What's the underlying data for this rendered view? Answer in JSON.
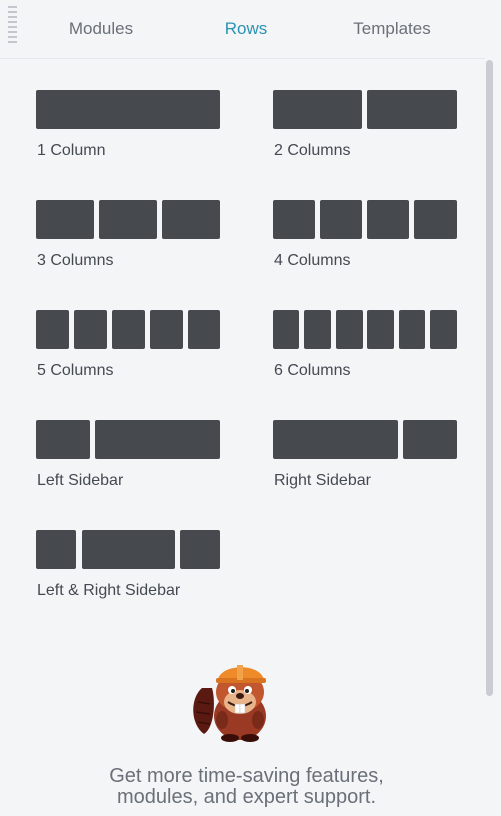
{
  "tabs": [
    {
      "label": "Modules",
      "active": false
    },
    {
      "label": "Rows",
      "active": true
    },
    {
      "label": "Templates",
      "active": false
    }
  ],
  "layouts": [
    {
      "id": "1col",
      "label": "1 Column"
    },
    {
      "id": "2col",
      "label": "2 Columns"
    },
    {
      "id": "3col",
      "label": "3 Columns"
    },
    {
      "id": "4col",
      "label": "4 Columns"
    },
    {
      "id": "5col",
      "label": "5 Columns"
    },
    {
      "id": "6col",
      "label": "6 Columns"
    },
    {
      "id": "left-sidebar",
      "label": "Left Sidebar"
    },
    {
      "id": "right-sidebar",
      "label": "Right Sidebar"
    },
    {
      "id": "left-right-sidebar",
      "label": "Left & Right Sidebar"
    }
  ],
  "promo": {
    "line1": "Get more time-saving features,",
    "line2": "modules, and expert support."
  },
  "colors": {
    "accent": "#2a93b3",
    "block": "#464a4f",
    "background": "#f4f5f7",
    "text": "#444a52"
  }
}
